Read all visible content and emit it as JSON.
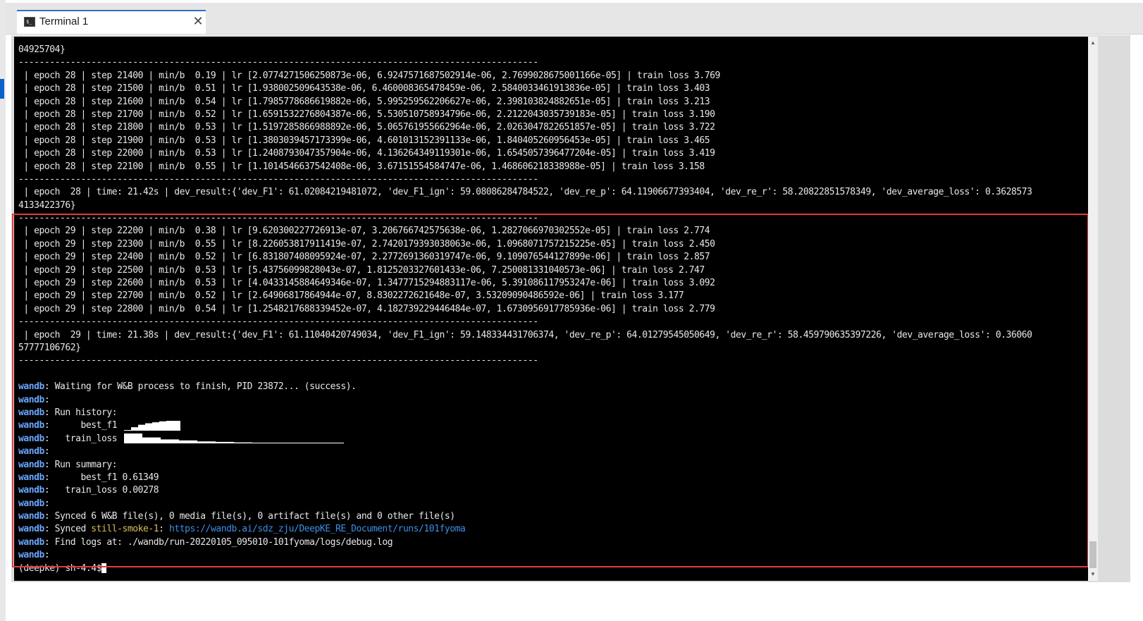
{
  "tab": {
    "title": "Terminal 1",
    "icon": "terminal-icon",
    "icon_glyph": "$_",
    "close_glyph": "✕"
  },
  "terminal": {
    "lines": [
      "04925704}",
      "----------------------------------------------------------------------------------------------------",
      " | epoch 28 | step 21400 | min/b  0.19 | lr [2.0774271506250873e-06, 6.9247571687502914e-06, 2.7699028675001166e-05] | train loss 3.769",
      " | epoch 28 | step 21500 | min/b  0.51 | lr [1.938002509643538e-06, 6.460008365478459e-06, 2.5840033461913836e-05] | train loss 3.403",
      " | epoch 28 | step 21600 | min/b  0.54 | lr [1.7985778686619882e-06, 5.995259562206627e-06, 2.398103824882651e-05] | train loss 3.213",
      " | epoch 28 | step 21700 | min/b  0.52 | lr [1.6591532276804387e-06, 5.530510758934796e-06, 2.2122043035739183e-05] | train loss 3.190",
      " | epoch 28 | step 21800 | min/b  0.53 | lr [1.5197285866988892e-06, 5.065761955662964e-06, 2.0263047822651857e-05] | train loss 3.722",
      " | epoch 28 | step 21900 | min/b  0.53 | lr [1.3803039457173399e-06, 4.601013152391133e-06, 1.840405260956453e-05] | train loss 3.465",
      " | epoch 28 | step 22000 | min/b  0.53 | lr [1.2408793047357904e-06, 4.136264349119301e-06, 1.6545057396477204e-05] | train loss 3.419",
      " | epoch 28 | step 22100 | min/b  0.55 | lr [1.1014546637542408e-06, 3.67151554584747e-06, 1.468606218338988e-05] | train loss 3.158",
      "----------------------------------------------------------------------------------------------------",
      " | epoch  28 | time: 21.42s | dev_result:{'dev_F1': 61.02084219481072, 'dev_F1_ign': 59.08086284784522, 'dev_re_p': 64.11906677393404, 'dev_re_r': 58.20822851578349, 'dev_average_loss': 0.3628573",
      "4133422376}",
      "----------------------------------------------------------------------------------------------------",
      " | epoch 29 | step 22200 | min/b  0.38 | lr [9.620300227726913e-07, 3.206766742575638e-06, 1.2827066970302552e-05] | train loss 2.774",
      " | epoch 29 | step 22300 | min/b  0.55 | lr [8.226053817911419e-07, 2.7420179393038063e-06, 1.0968071757215225e-05] | train loss 2.450",
      " | epoch 29 | step 22400 | min/b  0.52 | lr [6.831807408095924e-07, 2.2772691360319747e-06, 9.109076544127899e-06] | train loss 2.857",
      " | epoch 29 | step 22500 | min/b  0.53 | lr [5.43756099828043e-07, 1.8125203327601433e-06, 7.250081331040573e-06] | train loss 2.747",
      " | epoch 29 | step 22600 | min/b  0.53 | lr [4.0433145884649346e-07, 1.3477715294883117e-06, 5.391086117953247e-06] | train loss 3.092",
      " | epoch 29 | step 22700 | min/b  0.52 | lr [2.64906817864944e-07, 8.8302272621648e-07, 3.53209090486592e-06] | train loss 3.177",
      " | epoch 29 | step 22800 | min/b  0.54 | lr [1.2548217688339452e-07, 4.182739229446484e-07, 1.6730956917785936e-06] | train loss 2.779",
      "----------------------------------------------------------------------------------------------------",
      " | epoch  29 | time: 21.38s | dev_result:{'dev_F1': 61.11040420749034, 'dev_F1_ign': 59.148334431706374, 'dev_re_p': 64.01279545050649, 'dev_re_r': 58.459790635397226, 'dev_average_loss': 0.36060",
      "57777106762}",
      "----------------------------------------------------------------------------------------------------",
      ""
    ],
    "wandb_prefix": "wandb",
    "wandb_lines": [
      {
        "text": ": Waiting for W&B process to finish, PID 23872... (success)."
      },
      {
        "text": ":"
      },
      {
        "text": ": Run history:"
      },
      {
        "text": ":      best_f1 ",
        "spark": "best_f1"
      },
      {
        "text": ":   train_loss ",
        "spark": "train_loss"
      },
      {
        "text": ":"
      },
      {
        "text": ": Run summary:"
      },
      {
        "text": ":      best_f1 0.61349"
      },
      {
        "text": ":   train_loss 0.00278"
      },
      {
        "text": ":"
      },
      {
        "text": ": Synced 6 W&B file(s), 0 media file(s), 0 artifact file(s) and 0 other file(s)"
      },
      {
        "text": ": Synced ",
        "run_name": "still-smoke-1",
        "sep": ": ",
        "url": "https://wandb.ai/sdz_zju/DeepKE_RE_Document/runs/101fyoma"
      },
      {
        "text": ": Find logs at: ./wandb/run-20220105_095010-101fyoma/logs/debug.log"
      },
      {
        "text": ":"
      }
    ],
    "prompt": "(deepke) sh-4.4$"
  },
  "sparklines": {
    "best_f1": [
      0.05,
      0.35,
      0.6,
      0.75,
      0.85,
      0.95,
      1.0,
      1.0
    ],
    "train_loss": [
      1.0,
      0.6,
      0.4,
      0.3,
      0.2,
      0.15,
      0.1,
      0.05,
      0.03,
      0.02,
      0.01,
      0.0
    ]
  },
  "colors": {
    "highlight_border": "#e23b3b",
    "wandb_label": "#6aa7ff",
    "run_name": "#d8c05a",
    "url": "#3d8ee6"
  }
}
